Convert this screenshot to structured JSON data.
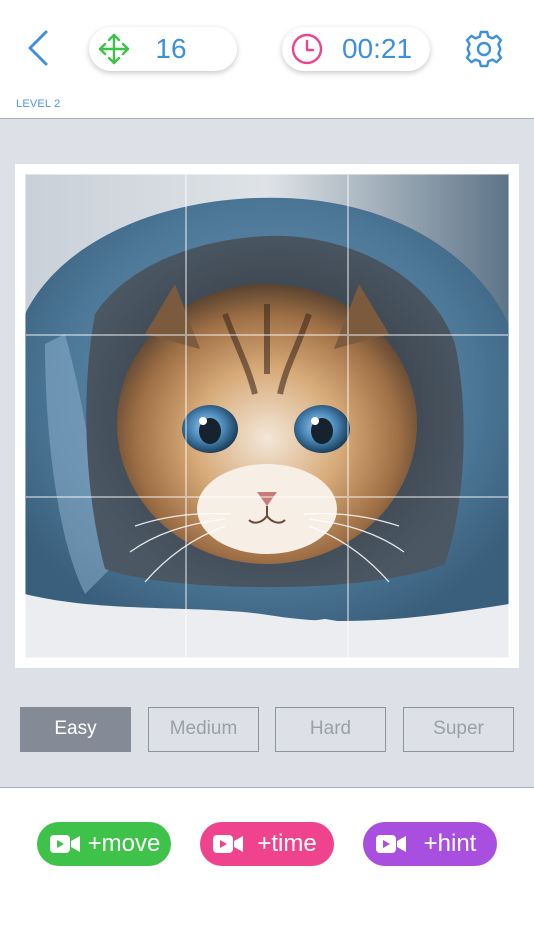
{
  "header": {
    "moves": "16",
    "time": "00:21",
    "level": "LEVEL 2"
  },
  "icons": {
    "back": "chevron-left-icon",
    "moves": "move-arrows-icon",
    "time": "clock-icon",
    "settings": "gear-icon",
    "video": "video-camera-icon"
  },
  "colors": {
    "accent_blue": "#3d8fe0",
    "moves_green": "#3fc24a",
    "clock_pink": "#f0438e",
    "board_bg": "#dde0e6",
    "active_difficulty": "#858b96"
  },
  "puzzle": {
    "grid_size": 3
  },
  "difficulty": {
    "selected": "Easy",
    "options": [
      "Easy",
      "Medium",
      "Hard",
      "Super"
    ]
  },
  "actions": {
    "move_label": "+move",
    "time_label": "+time",
    "hint_label": "+hint",
    "move_color": "#3fc24a",
    "time_color": "#f0438e",
    "hint_color": "#a94fe0"
  }
}
